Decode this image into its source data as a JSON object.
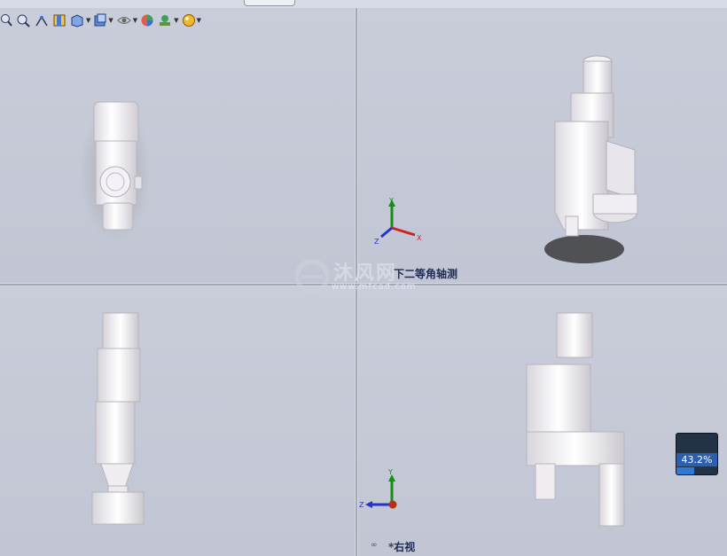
{
  "toolbar": {
    "items": [
      {
        "icon": "zoom-to-fit-icon"
      },
      {
        "icon": "zoom-to-area-icon"
      },
      {
        "icon": "previous-view-icon"
      },
      {
        "icon": "section-view-icon"
      },
      {
        "icon": "view-orientation-icon",
        "dropdown": true
      },
      {
        "icon": "display-style-icon",
        "dropdown": true
      },
      {
        "icon": "hide-show-items-icon",
        "dropdown": true
      },
      {
        "icon": "edit-appearance-icon"
      },
      {
        "icon": "apply-scene-icon",
        "dropdown": true
      },
      {
        "icon": "view-settings-icon",
        "dropdown": true
      }
    ]
  },
  "viewports": {
    "top_right": {
      "label": "下二等角轴测"
    },
    "bottom_right": {
      "label": "*右视"
    }
  },
  "triad": {
    "x": "X",
    "y": "Y",
    "z": "Z"
  },
  "progress": {
    "text": "43.2%",
    "value": 0.432
  },
  "watermark": {
    "brand": "沐风网",
    "url": "www.mfcad.com"
  },
  "colors": {
    "background": "#c4c8d6",
    "model": "#f2f0f4",
    "axis_x": "#cc2222",
    "axis_y": "#1a8a1a",
    "axis_z": "#2233cc"
  }
}
